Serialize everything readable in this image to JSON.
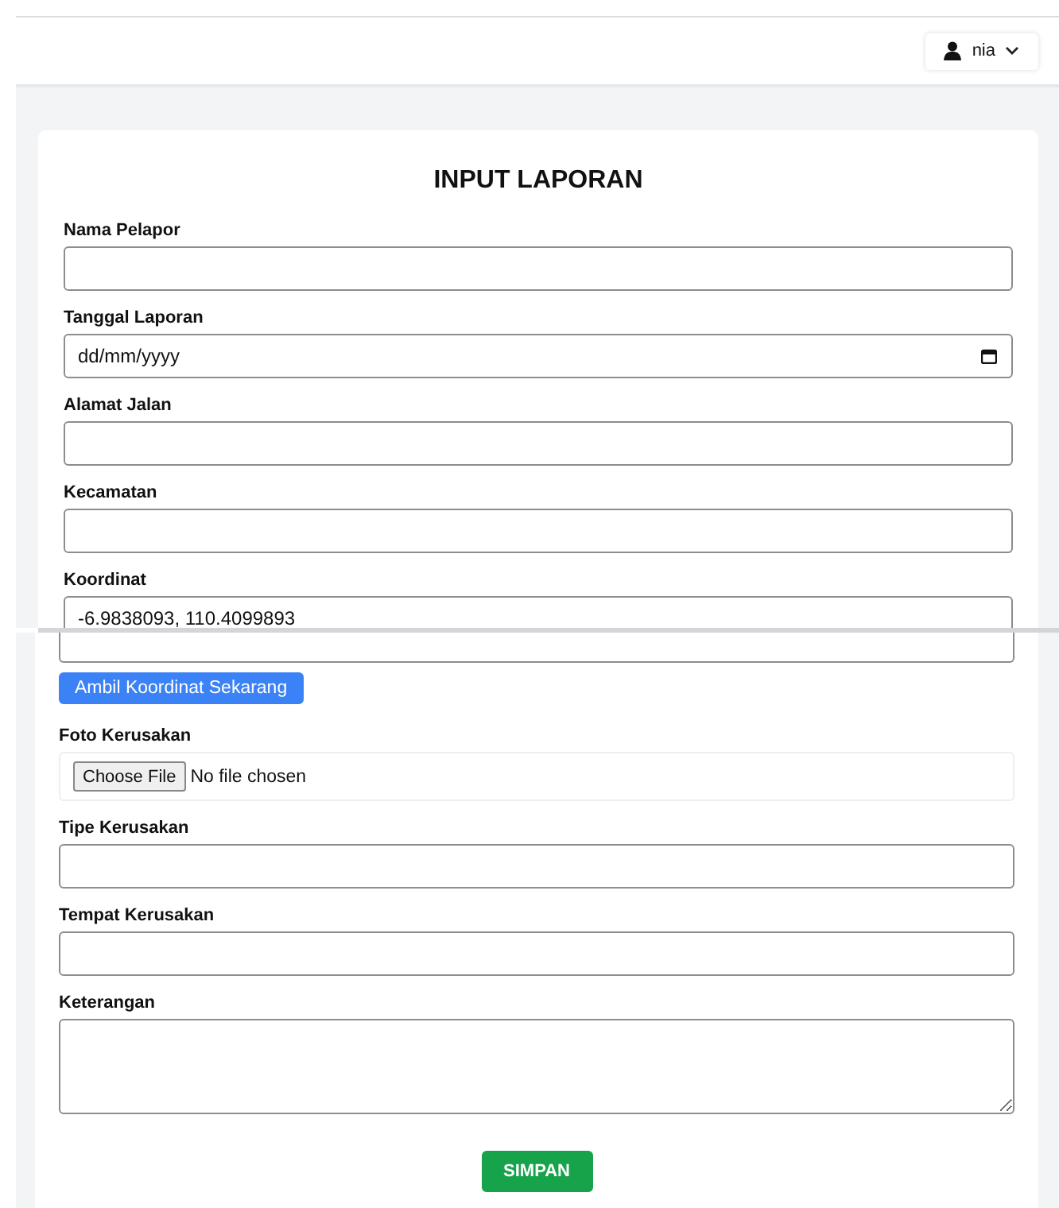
{
  "user_menu": {
    "name": "nia"
  },
  "screens": [
    {
      "title": "INPUT LAPORAN",
      "items": [
        {
          "kind": "text",
          "label": "Nama Pelapor"
        },
        {
          "kind": "date",
          "label": "Tanggal Laporan",
          "placeholder": "dd/mm/yyyy"
        },
        {
          "kind": "text",
          "label": "Alamat Jalan"
        },
        {
          "kind": "text",
          "label": "Kecamatan"
        },
        {
          "kind": "text",
          "label": "Koordinat",
          "value": "-6.9838093, 110.4099893"
        }
      ]
    },
    {
      "items": [
        {
          "kind": "field-end"
        },
        {
          "kind": "button",
          "label": "Ambil Koordinat Sekarang"
        },
        {
          "kind": "file",
          "label": "Foto Kerusakan",
          "button": "Choose File",
          "status": "No file chosen"
        },
        {
          "kind": "text",
          "label": "Tipe Kerusakan"
        },
        {
          "kind": "text",
          "label": "Tempat Kerusakan"
        },
        {
          "kind": "textarea",
          "label": "Keterangan"
        },
        {
          "kind": "submit",
          "label": "SIMPAN"
        }
      ]
    }
  ]
}
